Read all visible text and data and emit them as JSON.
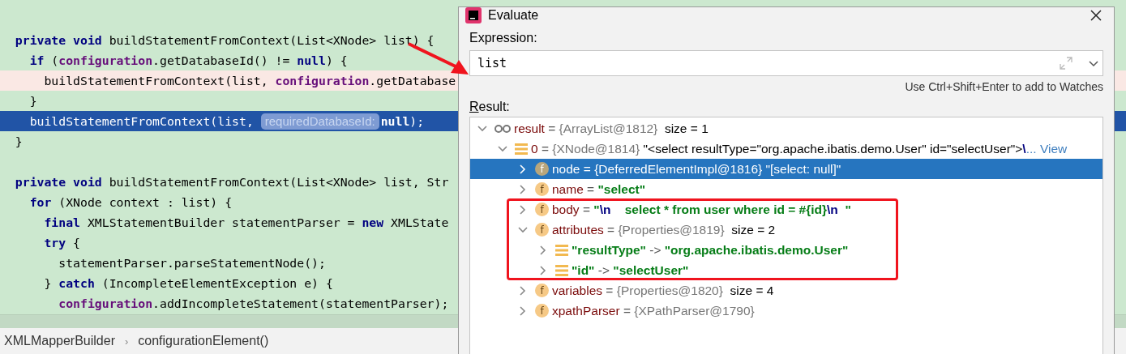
{
  "editor": {
    "lines": [
      {
        "kind": "normal",
        "tokens": [
          {
            "kind": "keyword",
            "text": "  private void"
          },
          {
            "kind": "plain",
            "text": " buildStatementFromContext(List<XNode> list) {"
          }
        ]
      },
      {
        "kind": "normal",
        "tokens": [
          {
            "kind": "keyword",
            "text": "    if"
          },
          {
            "kind": "plain",
            "text": " ("
          },
          {
            "kind": "field",
            "text": "configuration"
          },
          {
            "kind": "plain",
            "text": ".getDatabaseId() != "
          },
          {
            "kind": "keyword",
            "text": "null"
          },
          {
            "kind": "plain",
            "text": ") {"
          }
        ]
      },
      {
        "kind": "breakpoint",
        "tokens": [
          {
            "kind": "plain",
            "text": "      buildStatementFromContext(list, "
          },
          {
            "kind": "field",
            "text": "configuration"
          },
          {
            "kind": "plain",
            "text": ".getDatabase"
          }
        ]
      },
      {
        "kind": "normal",
        "tokens": [
          {
            "kind": "plain",
            "text": "    }"
          }
        ]
      },
      {
        "kind": "current",
        "tokens": [
          {
            "kind": "plain",
            "text": "    buildStatementFromContext(list, "
          },
          {
            "kind": "hint",
            "text": "requiredDatabaseId:"
          },
          {
            "kind": "keyword",
            "text": "null"
          },
          {
            "kind": "plain",
            "text": ");"
          }
        ]
      },
      {
        "kind": "normal",
        "tokens": [
          {
            "kind": "plain",
            "text": "  }"
          }
        ]
      },
      {
        "kind": "normal"
      },
      {
        "kind": "normal",
        "tokens": [
          {
            "kind": "keyword",
            "text": "  private void"
          },
          {
            "kind": "plain",
            "text": " buildStatementFromContext(List<XNode> list, Str"
          }
        ]
      },
      {
        "kind": "normal",
        "tokens": [
          {
            "kind": "keyword",
            "text": "    for"
          },
          {
            "kind": "plain",
            "text": " (XNode context : list) {"
          }
        ]
      },
      {
        "kind": "normal",
        "tokens": [
          {
            "kind": "keyword",
            "text": "      final"
          },
          {
            "kind": "plain",
            "text": " XMLStatementBuilder statementParser = "
          },
          {
            "kind": "keyword",
            "text": "new"
          },
          {
            "kind": "plain",
            "text": " XMLState"
          }
        ]
      },
      {
        "kind": "normal",
        "tokens": [
          {
            "kind": "keyword",
            "text": "      try"
          },
          {
            "kind": "plain",
            "text": " {"
          }
        ]
      },
      {
        "kind": "normal",
        "tokens": [
          {
            "kind": "plain",
            "text": "        statementParser.parseStatementNode();"
          }
        ]
      },
      {
        "kind": "normal",
        "tokens": [
          {
            "kind": "plain",
            "text": "      } "
          },
          {
            "kind": "keyword",
            "text": "catch"
          },
          {
            "kind": "plain",
            "text": " (IncompleteElementException e) {"
          }
        ]
      },
      {
        "kind": "normal",
        "tokens": [
          {
            "kind": "field",
            "text": "        configuration"
          },
          {
            "kind": "plain",
            "text": ".addIncompleteStatement(statementParser);"
          }
        ]
      }
    ]
  },
  "breadcrumbs": {
    "separator": "›",
    "items": [
      "XMLMapperBuilder",
      "configurationElement()"
    ]
  },
  "dialog": {
    "title": "Evaluate",
    "expression_label": "Expression:",
    "expression": "list",
    "hint": "Use Ctrl+Shift+Enter to add to Watches",
    "result_label": "Result:",
    "tree": [
      {
        "kind": "watch",
        "expanded": true,
        "selected": false,
        "tokens": [
          {
            "kind": "name",
            "text": "result"
          },
          {
            "kind": "op",
            "text": " = "
          },
          {
            "kind": "type",
            "text": "{ArrayList@1812}"
          },
          {
            "kind": "plain",
            "text": "  size = 1"
          }
        ],
        "children": [
          {
            "kind": "entry",
            "expanded": true,
            "selected": false,
            "tokens": [
              {
                "kind": "name",
                "text": "0"
              },
              {
                "kind": "op",
                "text": " = "
              },
              {
                "kind": "type",
                "text": "{XNode@1814}"
              },
              {
                "kind": "plain",
                "text": " \"<select resultType=\"org.apache.ibatis.demo.User\" id=\"selectUser\">"
              },
              {
                "kind": "escape",
                "text": "\\"
              },
              {
                "kind": "link",
                "text": "... View"
              }
            ],
            "children": [
              {
                "kind": "field",
                "icon_letter": "f",
                "expanded": false,
                "selected": true,
                "tokens": [
                  {
                    "kind": "name",
                    "text": "node"
                  },
                  {
                    "kind": "op",
                    "text": " = "
                  },
                  {
                    "kind": "type",
                    "text": "{DeferredElementImpl@1816}"
                  },
                  {
                    "kind": "plain",
                    "text": " \"[select: null]\""
                  }
                ]
              },
              {
                "kind": "field",
                "icon_letter": "f",
                "expanded": false,
                "selected": false,
                "tokens": [
                  {
                    "kind": "name",
                    "text": "name"
                  },
                  {
                    "kind": "op",
                    "text": " = "
                  },
                  {
                    "kind": "string",
                    "text": "\"select\""
                  }
                ]
              },
              {
                "kind": "field",
                "icon_letter": "f",
                "expanded": false,
                "selected": false,
                "tokens": [
                  {
                    "kind": "name",
                    "text": "body"
                  },
                  {
                    "kind": "op",
                    "text": " = "
                  },
                  {
                    "kind": "string",
                    "text": "\""
                  },
                  {
                    "kind": "escape",
                    "text": "\\n"
                  },
                  {
                    "kind": "string",
                    "text": "    select * from user where id = #{id}"
                  },
                  {
                    "kind": "escape",
                    "text": "\\n"
                  },
                  {
                    "kind": "string",
                    "text": "  \""
                  }
                ]
              },
              {
                "kind": "field",
                "icon_letter": "f",
                "expanded": true,
                "selected": false,
                "tokens": [
                  {
                    "kind": "name",
                    "text": "attributes"
                  },
                  {
                    "kind": "op",
                    "text": " = "
                  },
                  {
                    "kind": "type",
                    "text": "{Properties@1819}"
                  },
                  {
                    "kind": "plain",
                    "text": "  size = 2"
                  }
                ],
                "children": [
                  {
                    "kind": "entry",
                    "expanded": false,
                    "selected": false,
                    "tokens": [
                      {
                        "kind": "string",
                        "text": "\"resultType\""
                      },
                      {
                        "kind": "op",
                        "text": " -> "
                      },
                      {
                        "kind": "string",
                        "text": "\"org.apache.ibatis.demo.User\""
                      }
                    ]
                  },
                  {
                    "kind": "entry",
                    "expanded": false,
                    "selected": false,
                    "tokens": [
                      {
                        "kind": "string",
                        "text": "\"id\""
                      },
                      {
                        "kind": "op",
                        "text": " -> "
                      },
                      {
                        "kind": "string",
                        "text": "\"selectUser\""
                      }
                    ]
                  }
                ]
              },
              {
                "kind": "field",
                "icon_letter": "f",
                "expanded": false,
                "selected": false,
                "tokens": [
                  {
                    "kind": "name",
                    "text": "variables"
                  },
                  {
                    "kind": "op",
                    "text": " = "
                  },
                  {
                    "kind": "type",
                    "text": "{Properties@1820}"
                  },
                  {
                    "kind": "plain",
                    "text": "  size = 4"
                  }
                ]
              },
              {
                "kind": "field",
                "icon_letter": "f",
                "expanded": false,
                "selected": false,
                "tokens": [
                  {
                    "kind": "name",
                    "text": "xpathParser"
                  },
                  {
                    "kind": "op",
                    "text": " = "
                  },
                  {
                    "kind": "type",
                    "text": "{XPathParser@1790}"
                  }
                ]
              }
            ]
          }
        ]
      }
    ]
  }
}
